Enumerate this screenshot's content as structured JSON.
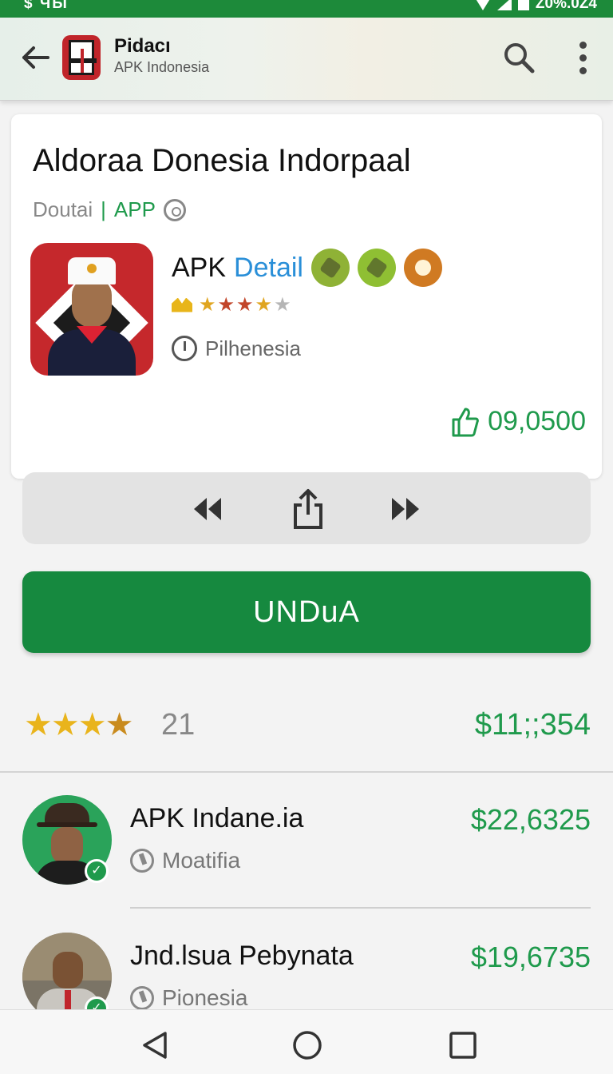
{
  "status_bar": {
    "left": "$ ЧЫ",
    "right": "Z0%.0Z4"
  },
  "app_bar": {
    "title": "Pidacı",
    "subtitle": "APK Indonesia",
    "icons": [
      "back-arrow-icon",
      "search-icon",
      "more-vert-icon"
    ]
  },
  "card": {
    "title": "Aldoraa Donesia Indorpaal",
    "developer": "Doutai",
    "separator": "|",
    "type": "APP",
    "detail_prefix": "APK",
    "detail_label": "Detail",
    "rating_stars": 4.5,
    "location": "Pilhenesia",
    "likes": "09,0500"
  },
  "controls": {
    "icons": [
      "rewind-icon",
      "share-icon",
      "fast-forward-icon"
    ]
  },
  "download": {
    "label": "UNDuA"
  },
  "summary": {
    "stars": 3.5,
    "count": "21",
    "price": "$11;;354"
  },
  "list": {
    "items": [
      {
        "name": "APK Indane.ia",
        "sub": "Moatifia",
        "price": "$22,6325"
      },
      {
        "name": "Jnd.lsua Pebynata",
        "sub": "Pionesia",
        "price": "$19,6735"
      }
    ]
  },
  "nav": {
    "icons": [
      "nav-back-icon",
      "nav-home-icon",
      "nav-recents-icon"
    ]
  },
  "colors": {
    "primary": "#16893f",
    "accent_text": "#1f9a4c",
    "link_blue": "#2a8fd8",
    "status_bar": "#1d8a3a"
  }
}
